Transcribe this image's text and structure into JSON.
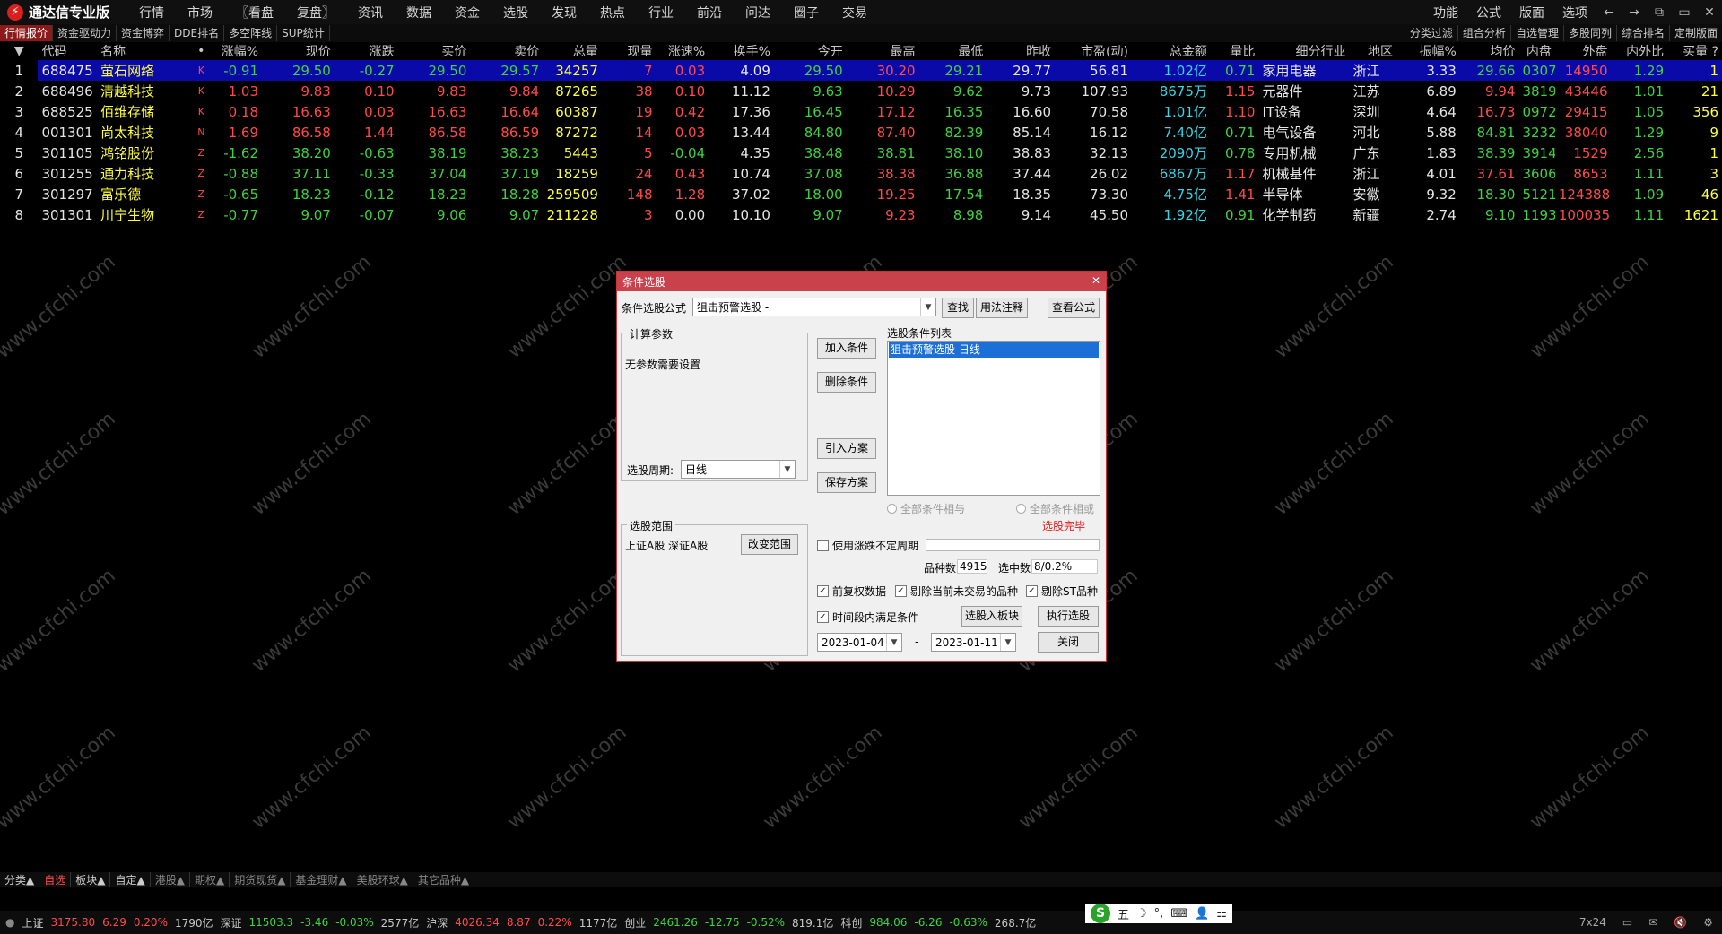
{
  "app": {
    "title": "通达信专业版"
  },
  "menu": [
    "行情",
    "市场",
    "〖看盘",
    "复盘〗",
    "资讯",
    "数据",
    "资金",
    "选股",
    "发现",
    "热点",
    "行业",
    "前沿",
    "问达",
    "圈子",
    "交易"
  ],
  "menu_right": [
    "功能",
    "公式",
    "版面",
    "选项"
  ],
  "window_buttons": {
    "back": "←",
    "forward": "→",
    "restore": "⧉",
    "maximize": "▭",
    "close": "✕"
  },
  "tabs": [
    "行情报价",
    "资金驱动力",
    "资金博弈",
    "DDE排名",
    "多空阵线",
    "SUP统计"
  ],
  "tabs_right": [
    "分类过滤",
    "组合分析",
    "自选管理",
    "多股同列",
    "综合排名",
    "定制版面"
  ],
  "table": {
    "headers": [
      "▼",
      "代码",
      "名称",
      "•",
      "涨幅%",
      "现价",
      "涨跌",
      "买价",
      "卖价",
      "总量",
      "现量",
      "涨速%",
      "换手%",
      "今开",
      "最高",
      "最低",
      "昨收",
      "市盈(动)",
      "总金额",
      "量比",
      "细分行业",
      "地区",
      "振幅%",
      "均价",
      "内盘",
      "外盘",
      "内外比",
      "买量 ?"
    ],
    "rows": [
      [
        "1",
        "688475",
        "萤石网络",
        "K",
        "-0.91",
        "29.50",
        "-0.27",
        "29.50",
        "29.57",
        "34257",
        "7",
        "0.03",
        "4.09",
        "29.50",
        "30.20",
        "29.21",
        "29.77",
        "56.81",
        "1.02亿",
        "0.71",
        "家用电器",
        "浙江",
        "3.33",
        "29.66",
        "0307",
        "14950",
        "1.29",
        "1"
      ],
      [
        "2",
        "688496",
        "清越科技",
        "K",
        "1.03",
        "9.83",
        "0.10",
        "9.83",
        "9.84",
        "87265",
        "38",
        "0.10",
        "11.12",
        "9.63",
        "10.29",
        "9.62",
        "9.73",
        "107.93",
        "8675万",
        "1.15",
        "元器件",
        "江苏",
        "6.89",
        "9.94",
        "3819",
        "43446",
        "1.01",
        "21"
      ],
      [
        "3",
        "688525",
        "佰维存储",
        "K",
        "0.18",
        "16.63",
        "0.03",
        "16.63",
        "16.64",
        "60387",
        "19",
        "0.42",
        "17.36",
        "16.45",
        "17.12",
        "16.35",
        "16.60",
        "70.58",
        "1.01亿",
        "1.10",
        "IT设备",
        "深圳",
        "4.64",
        "16.73",
        "0972",
        "29415",
        "1.05",
        "356"
      ],
      [
        "4",
        "001301",
        "尚太科技",
        "N",
        "1.69",
        "86.58",
        "1.44",
        "86.58",
        "86.59",
        "87272",
        "14",
        "0.03",
        "13.44",
        "84.80",
        "87.40",
        "82.39",
        "85.14",
        "16.12",
        "7.40亿",
        "0.71",
        "电气设备",
        "河北",
        "5.88",
        "84.81",
        "3232",
        "38040",
        "1.29",
        "9"
      ],
      [
        "5",
        "301105",
        "鸿铭股份",
        "Z",
        "-1.62",
        "38.20",
        "-0.63",
        "38.19",
        "38.23",
        "5443",
        "5",
        "-0.04",
        "4.35",
        "38.48",
        "38.81",
        "38.10",
        "38.83",
        "32.13",
        "2090万",
        "0.78",
        "专用机械",
        "广东",
        "1.83",
        "38.39",
        "3914",
        "1529",
        "2.56",
        "1"
      ],
      [
        "6",
        "301255",
        "通力科技",
        "Z",
        "-0.88",
        "37.11",
        "-0.33",
        "37.04",
        "37.19",
        "18259",
        "24",
        "0.43",
        "10.74",
        "37.08",
        "38.38",
        "36.88",
        "37.44",
        "26.02",
        "6867万",
        "1.17",
        "机械基件",
        "浙江",
        "4.01",
        "37.61",
        "3606",
        "8653",
        "1.11",
        "3"
      ],
      [
        "7",
        "301297",
        "富乐德",
        "Z",
        "-0.65",
        "18.23",
        "-0.12",
        "18.23",
        "18.28",
        "259509",
        "148",
        "1.28",
        "37.02",
        "18.00",
        "19.25",
        "17.54",
        "18.35",
        "73.30",
        "4.75亿",
        "1.41",
        "半导体",
        "安徽",
        "9.32",
        "18.30",
        "5121",
        "124388",
        "1.09",
        "46"
      ],
      [
        "8",
        "301301",
        "川宁生物",
        "Z",
        "-0.77",
        "9.07",
        "-0.07",
        "9.06",
        "9.07",
        "211228",
        "3",
        "0.00",
        "10.10",
        "9.07",
        "9.23",
        "8.98",
        "9.14",
        "45.50",
        "1.92亿",
        "0.91",
        "化学制药",
        "新疆",
        "2.74",
        "9.10",
        "1193",
        "100035",
        "1.11",
        "1621"
      ]
    ]
  },
  "colors": {
    "up": "#ff4a4a",
    "down": "#3fd23f",
    "flat": "#e0e0e0",
    "yellow": "#ffff3a",
    "cyan": "#36d6e6",
    "white": "#e6e6e6"
  },
  "watermark": "www.cfchi.com",
  "dialog": {
    "title": "条件选股",
    "formula_label": "条件选股公式",
    "formula_value": "狙击预警选股 -",
    "btn_find": "查找",
    "btn_usage": "用法注释",
    "btn_view": "查看公式",
    "params_group": "计算参数",
    "params_text": "无参数需要设置",
    "period_label": "选股周期:",
    "period_value": "日线",
    "btn_add": "加入条件",
    "btn_delete": "删除条件",
    "btn_import": "引入方案",
    "btn_save": "保存方案",
    "list_label": "选股条件列表",
    "list_items": [
      "狙击预警选股  日线"
    ],
    "radio_and": "全部条件相与",
    "radio_or": "全部条件相或",
    "done_text": "选股完毕",
    "range_group": "选股范围",
    "range_text": "上证A股 深证A股",
    "btn_change_range": "改变范围",
    "chk_variable_period": "使用涨跌不定周期",
    "count_label": "品种数",
    "count_value": "4915",
    "selected_label": "选中数",
    "selected_value": "8/0.2%",
    "chk_adjust": "前复权数据",
    "chk_exclude_untraded": "剔除当前未交易的品种",
    "chk_exclude_st": "剔除ST品种",
    "chk_time_range": "时间段内满足条件",
    "btn_to_block": "选股入板块",
    "btn_execute": "执行选股",
    "date_from": "2023-01-04",
    "date_to": "2023-01-11",
    "date_sep": "-",
    "btn_close": "关闭"
  },
  "sectors": [
    "分类▲",
    "自选",
    "板块▲",
    "自定▲",
    "港股▲",
    "期权▲",
    "期货现货▲",
    "基金理财▲",
    "美股环球▲",
    "其它品种▲"
  ],
  "status": {
    "items": [
      {
        "t": "上证",
        "c": "white"
      },
      {
        "t": "3175.80",
        "c": "up"
      },
      {
        "t": "6.29",
        "c": "up"
      },
      {
        "t": "0.20%",
        "c": "up"
      },
      {
        "t": "1790亿",
        "c": "white"
      },
      {
        "t": "深证",
        "c": "white"
      },
      {
        "t": "11503.3",
        "c": "down"
      },
      {
        "t": "-3.46",
        "c": "down"
      },
      {
        "t": "-0.03%",
        "c": "down"
      },
      {
        "t": "2577亿",
        "c": "white"
      },
      {
        "t": "沪深",
        "c": "white"
      },
      {
        "t": "4026.34",
        "c": "up"
      },
      {
        "t": "8.87",
        "c": "up"
      },
      {
        "t": "0.22%",
        "c": "up"
      },
      {
        "t": "1177亿",
        "c": "white"
      },
      {
        "t": "创业",
        "c": "white"
      },
      {
        "t": "2461.26",
        "c": "down"
      },
      {
        "t": "-12.75",
        "c": "down"
      },
      {
        "t": "-0.52%",
        "c": "down"
      },
      {
        "t": "819.1亿",
        "c": "white"
      },
      {
        "t": "科创",
        "c": "white"
      },
      {
        "t": "984.06",
        "c": "down"
      },
      {
        "t": "-6.26",
        "c": "down"
      },
      {
        "t": "-0.63%",
        "c": "down"
      },
      {
        "t": "268.7亿",
        "c": "white"
      }
    ],
    "ime": {
      "logo": "S",
      "mode": "五",
      "moon": "☽",
      "punct": "°,",
      "kbd": "⌨",
      "user": "👤",
      "grid": "⚏"
    },
    "right": "7x24"
  }
}
